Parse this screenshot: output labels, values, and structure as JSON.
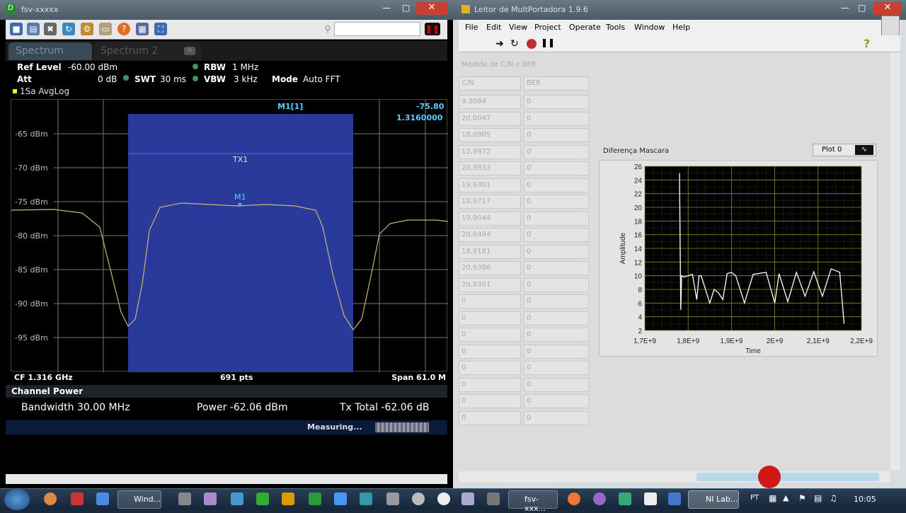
{
  "spectrum_window": {
    "title": "fsv-xxxxx",
    "tabs": [
      "Spectrum",
      "Spectrum 2"
    ],
    "settings": {
      "ref_level_label": "Ref Level",
      "ref_level_value": "-60.00 dBm",
      "att_label": "Att",
      "att_value": "0 dB",
      "swt_label": "SWT",
      "swt_value": "30 ms",
      "rbw_label": "RBW",
      "rbw_value": "1 MHz",
      "vbw_label": "VBW",
      "vbw_value": "3 kHz",
      "mode_label": "Mode",
      "mode_value": "Auto FFT"
    },
    "trace_label": "1Sa AvgLog",
    "marker_header": "M1[1]",
    "marker_value": "-75.80",
    "marker_freq": "1.3160000",
    "tx_label": "TX1",
    "marker_label": "M1",
    "y_ticks": [
      "-65 dBm",
      "-70 dBm",
      "-75 dBm",
      "-80 dBm",
      "-85 dBm",
      "-90 dBm",
      "-95 dBm"
    ],
    "footer": {
      "cf": "CF 1.316 GHz",
      "pts": "691 pts",
      "span": "Span 61.0 M"
    },
    "channel_power": {
      "title": "Channel Power",
      "bandwidth": "Bandwidth 30.00 MHz",
      "power": "Power -62.06 dBm",
      "tx_total": "Tx Total -62.06 dB"
    },
    "status": "Measuring..."
  },
  "labview_window": {
    "title": "Leitor de MultPortadora 1.9.6",
    "menu": [
      "File",
      "Edit",
      "View",
      "Project",
      "Operate",
      "Tools",
      "Window",
      "Help"
    ],
    "table_title": "Medida de C/N e BER",
    "col_headers": [
      "C/N",
      "BER"
    ],
    "cn_values": [
      "9,3084",
      "20,0047",
      "18,0905",
      "12,9472",
      "20,9833",
      "19,6301",
      "18,9717",
      "19,9044",
      "20,8494",
      "18,9181",
      "20,9386",
      "20,8301",
      "0",
      "0",
      "0",
      "0",
      "0",
      "0",
      "0",
      "0"
    ],
    "ber_values": [
      "0",
      "0",
      "0",
      "0",
      "0",
      "0",
      "0",
      "0",
      "0",
      "0",
      "0",
      "0",
      "0",
      "0",
      "0",
      "0",
      "0",
      "0",
      "0",
      "0"
    ],
    "graph_title": "Diferença Mascara",
    "legend": "Plot 0",
    "colors": {
      "graph_bg": "#000000",
      "grid": "#8a8a30",
      "trace": "#ffffff"
    }
  },
  "chart_data": {
    "type": "line",
    "title": "Diferença Mascara",
    "xlabel": "Time",
    "ylabel": "Amplitude",
    "xlim": [
      1700000000.0,
      2200000000.0
    ],
    "ylim": [
      2,
      26
    ],
    "x_ticks": [
      "1,7E+9",
      "1,8E+9",
      "1,9E+9",
      "2E+9",
      "2,1E+9",
      "2,2E+9"
    ],
    "y_ticks": [
      "2",
      "4",
      "6",
      "8",
      "10",
      "12",
      "14",
      "16",
      "18",
      "20",
      "22",
      "24",
      "26"
    ],
    "series": [
      {
        "name": "Plot 0",
        "x": [
          1780000000.0,
          1783000000.0,
          1785000000.0,
          1790000000.0,
          1810000000.0,
          1820000000.0,
          1825000000.0,
          1830000000.0,
          1850000000.0,
          1860000000.0,
          1870000000.0,
          1880000000.0,
          1890000000.0,
          1900000000.0,
          1910000000.0,
          1930000000.0,
          1950000000.0,
          1980000000.0,
          2000000000.0,
          2010000000.0,
          2030000000.0,
          2050000000.0,
          2070000000.0,
          2090000000.0,
          2110000000.0,
          2130000000.0,
          2150000000.0,
          2160000000.0
        ],
        "y": [
          25,
          5,
          10,
          9.8,
          10.2,
          6.5,
          10,
          10,
          6,
          8,
          7.5,
          6.5,
          10.3,
          10.5,
          10,
          6,
          10.2,
          10.5,
          6,
          10.3,
          6.2,
          10.5,
          7,
          10.6,
          7,
          11,
          10.5,
          3
        ]
      }
    ]
  },
  "taskbar": {
    "items": [
      "Wind...",
      "fsv-xxx...",
      "NI Lab..."
    ],
    "lang": "PT",
    "clock": "10:05"
  }
}
